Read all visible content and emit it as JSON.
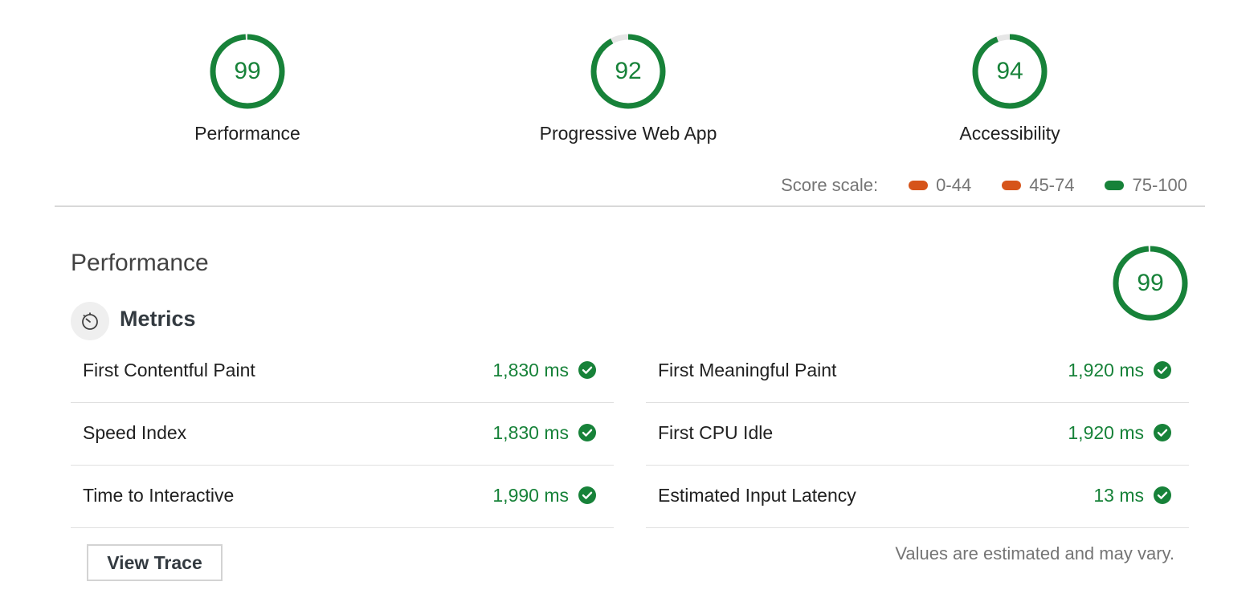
{
  "summary": {
    "gauges": [
      {
        "score": "99",
        "label": "Performance",
        "value": 0.99
      },
      {
        "score": "92",
        "label": "Progressive Web App",
        "value": 0.92
      },
      {
        "score": "94",
        "label": "Accessibility",
        "value": 0.94
      }
    ]
  },
  "score_scale": {
    "label": "Score scale:",
    "ranges": [
      {
        "text": "0-44",
        "color": "#d6541a"
      },
      {
        "text": "45-74",
        "color": "#d6541a"
      },
      {
        "text": "75-100",
        "color": "#178239"
      }
    ]
  },
  "performance": {
    "title": "Performance",
    "score": "99",
    "value": 0.99,
    "metrics_title": "Metrics",
    "metrics_icon": "stopwatch-icon",
    "metrics_left": [
      {
        "name": "First Contentful Paint",
        "value": "1,830 ms"
      },
      {
        "name": "Speed Index",
        "value": "1,830 ms"
      },
      {
        "name": "Time to Interactive",
        "value": "1,990 ms"
      }
    ],
    "metrics_right": [
      {
        "name": "First Meaningful Paint",
        "value": "1,920 ms"
      },
      {
        "name": "First CPU Idle",
        "value": "1,920 ms"
      },
      {
        "name": "Estimated Input Latency",
        "value": "13 ms"
      }
    ],
    "pass_icon": "check-circle-icon",
    "view_trace_label": "View Trace",
    "disclaimer": "Values are estimated and may vary."
  },
  "colors": {
    "pass": "#178239",
    "pass_track": "#e6e6e6",
    "average": "#d6541a"
  }
}
